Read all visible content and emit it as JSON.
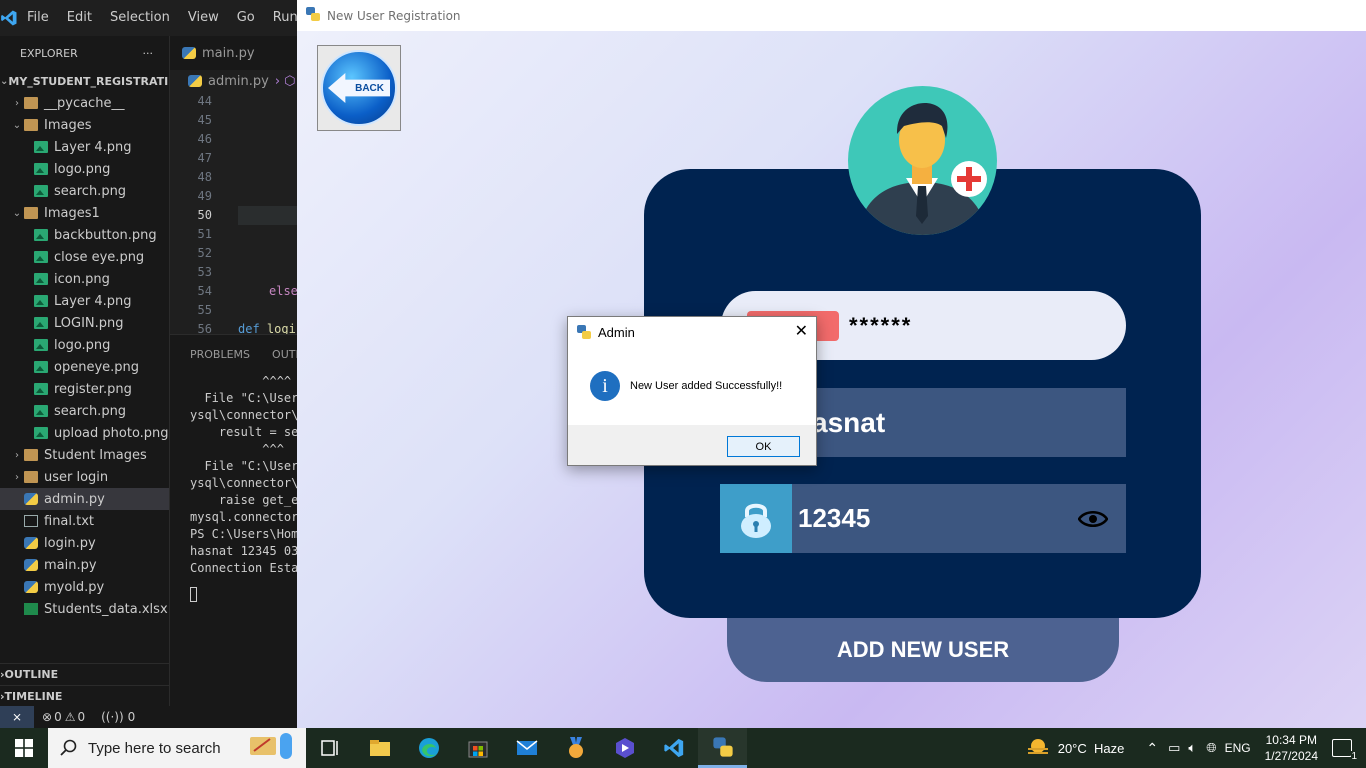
{
  "vscode": {
    "menu": [
      "File",
      "Edit",
      "Selection",
      "View",
      "Go",
      "Run"
    ],
    "explorer_title": "EXPLORER",
    "explorer_more": "···",
    "project": "MY_STUDENT_REGISTRATI...",
    "tree": [
      {
        "label": "__pycache__",
        "kind": "folder",
        "indent": 1,
        "chev": "›"
      },
      {
        "label": "Images",
        "kind": "folder",
        "indent": 1,
        "chev": "⌄"
      },
      {
        "label": "Layer 4.png",
        "kind": "img",
        "indent": 2
      },
      {
        "label": "logo.png",
        "kind": "img",
        "indent": 2
      },
      {
        "label": "search.png",
        "kind": "img",
        "indent": 2
      },
      {
        "label": "Images1",
        "kind": "folder",
        "indent": 1,
        "chev": "⌄"
      },
      {
        "label": "backbutton.png",
        "kind": "img",
        "indent": 2
      },
      {
        "label": "close eye.png",
        "kind": "img",
        "indent": 2
      },
      {
        "label": "icon.png",
        "kind": "img",
        "indent": 2
      },
      {
        "label": "Layer 4.png",
        "kind": "img",
        "indent": 2
      },
      {
        "label": "LOGIN.png",
        "kind": "img",
        "indent": 2
      },
      {
        "label": "logo.png",
        "kind": "img",
        "indent": 2
      },
      {
        "label": "openeye.png",
        "kind": "img",
        "indent": 2
      },
      {
        "label": "register.png",
        "kind": "img",
        "indent": 2
      },
      {
        "label": "search.png",
        "kind": "img",
        "indent": 2
      },
      {
        "label": "upload photo.png",
        "kind": "img",
        "indent": 2
      },
      {
        "label": "Student Images",
        "kind": "folder",
        "indent": 1,
        "chev": "›"
      },
      {
        "label": "user login",
        "kind": "folder",
        "indent": 1,
        "chev": "›"
      },
      {
        "label": "admin.py",
        "kind": "py",
        "indent": 1,
        "active": true
      },
      {
        "label": "final.txt",
        "kind": "txt",
        "indent": 1
      },
      {
        "label": "login.py",
        "kind": "py",
        "indent": 1
      },
      {
        "label": "main.py",
        "kind": "py",
        "indent": 1
      },
      {
        "label": "myold.py",
        "kind": "py",
        "indent": 1
      },
      {
        "label": "Students_data.xlsx",
        "kind": "xls",
        "indent": 1
      }
    ],
    "outline": "OUTLINE",
    "timeline": "TIMELINE",
    "tab": "main.py",
    "breadcrumb": "admin.py",
    "line_numbers": [
      "44",
      "45",
      "46",
      "47",
      "48",
      "49",
      "50",
      "51",
      "52",
      "53",
      "54",
      "55",
      "56"
    ],
    "code_else": "else",
    "code_def": "def",
    "code_logi": " logi",
    "panel_tabs": [
      "PROBLEMS",
      "OUTPU"
    ],
    "terminal": [
      "          ^^^^",
      "  File \"C:\\Users",
      "ysql\\connector\\",
      "    result = se",
      "          ^^^",
      "  File \"C:\\Users",
      "ysql\\connector\\",
      "    raise get_e",
      "mysql.connector",
      "PS C:\\Users\\Hom",
      "hasnat 12345 03",
      "Connection Esta"
    ],
    "status_errors": "0",
    "status_warnings": "0",
    "status_ports": "0"
  },
  "app": {
    "title": "New User Registration",
    "back_label": "BACK",
    "password_value": "******",
    "username_value": "asnat",
    "pin_value": "12345",
    "add_button": "ADD NEW USER"
  },
  "dialog": {
    "title": "Admin",
    "message": "New User added Successfully!!",
    "ok": "OK"
  },
  "taskbar": {
    "search_placeholder": "Type here to search",
    "weather": "20°C  Haze",
    "lang": "ENG",
    "time": "10:34 PM",
    "date": "1/27/2024",
    "notifications": "1"
  }
}
